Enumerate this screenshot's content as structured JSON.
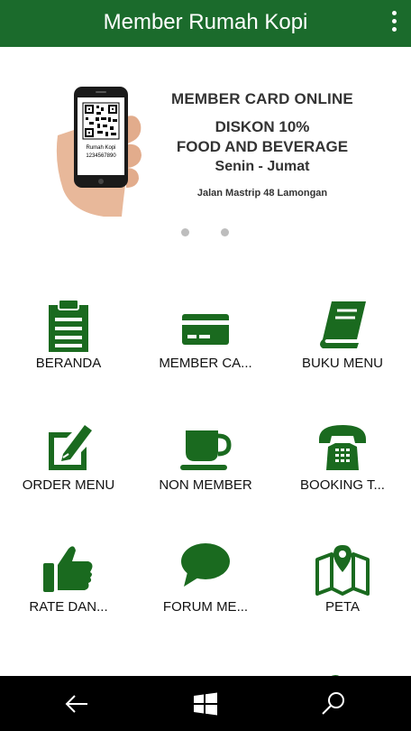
{
  "app": {
    "title": "Member Rumah Kopi"
  },
  "banner": {
    "phone_brand": "Rumah Kopi",
    "phone_number": "1234567890",
    "line1": "MEMBER CARD ONLINE",
    "line2": "DISKON 10%",
    "line3": "FOOD AND BEVERAGE",
    "line4": "Senin - Jumat",
    "line5": "Jalan Mastrip 48 Lamongan"
  },
  "menu": [
    {
      "label": "BERANDA",
      "icon": "clipboard-icon"
    },
    {
      "label": "MEMBER CA...",
      "icon": "credit-card-icon"
    },
    {
      "label": "BUKU MENU",
      "icon": "book-icon"
    },
    {
      "label": "ORDER MENU",
      "icon": "edit-icon"
    },
    {
      "label": "NON MEMBER",
      "icon": "coffee-cup-icon"
    },
    {
      "label": "BOOKING T...",
      "icon": "phone-icon"
    },
    {
      "label": "RATE DAN...",
      "icon": "thumbs-up-icon"
    },
    {
      "label": "FORUM ME...",
      "icon": "chat-bubble-icon"
    },
    {
      "label": "PETA",
      "icon": "map-icon"
    }
  ],
  "colors": {
    "accent": "#1b6b2c",
    "icon": "#1a6a1f",
    "navbar": "#000000"
  },
  "navbar": {
    "icons": [
      "back-icon",
      "windows-icon",
      "search-icon"
    ]
  }
}
